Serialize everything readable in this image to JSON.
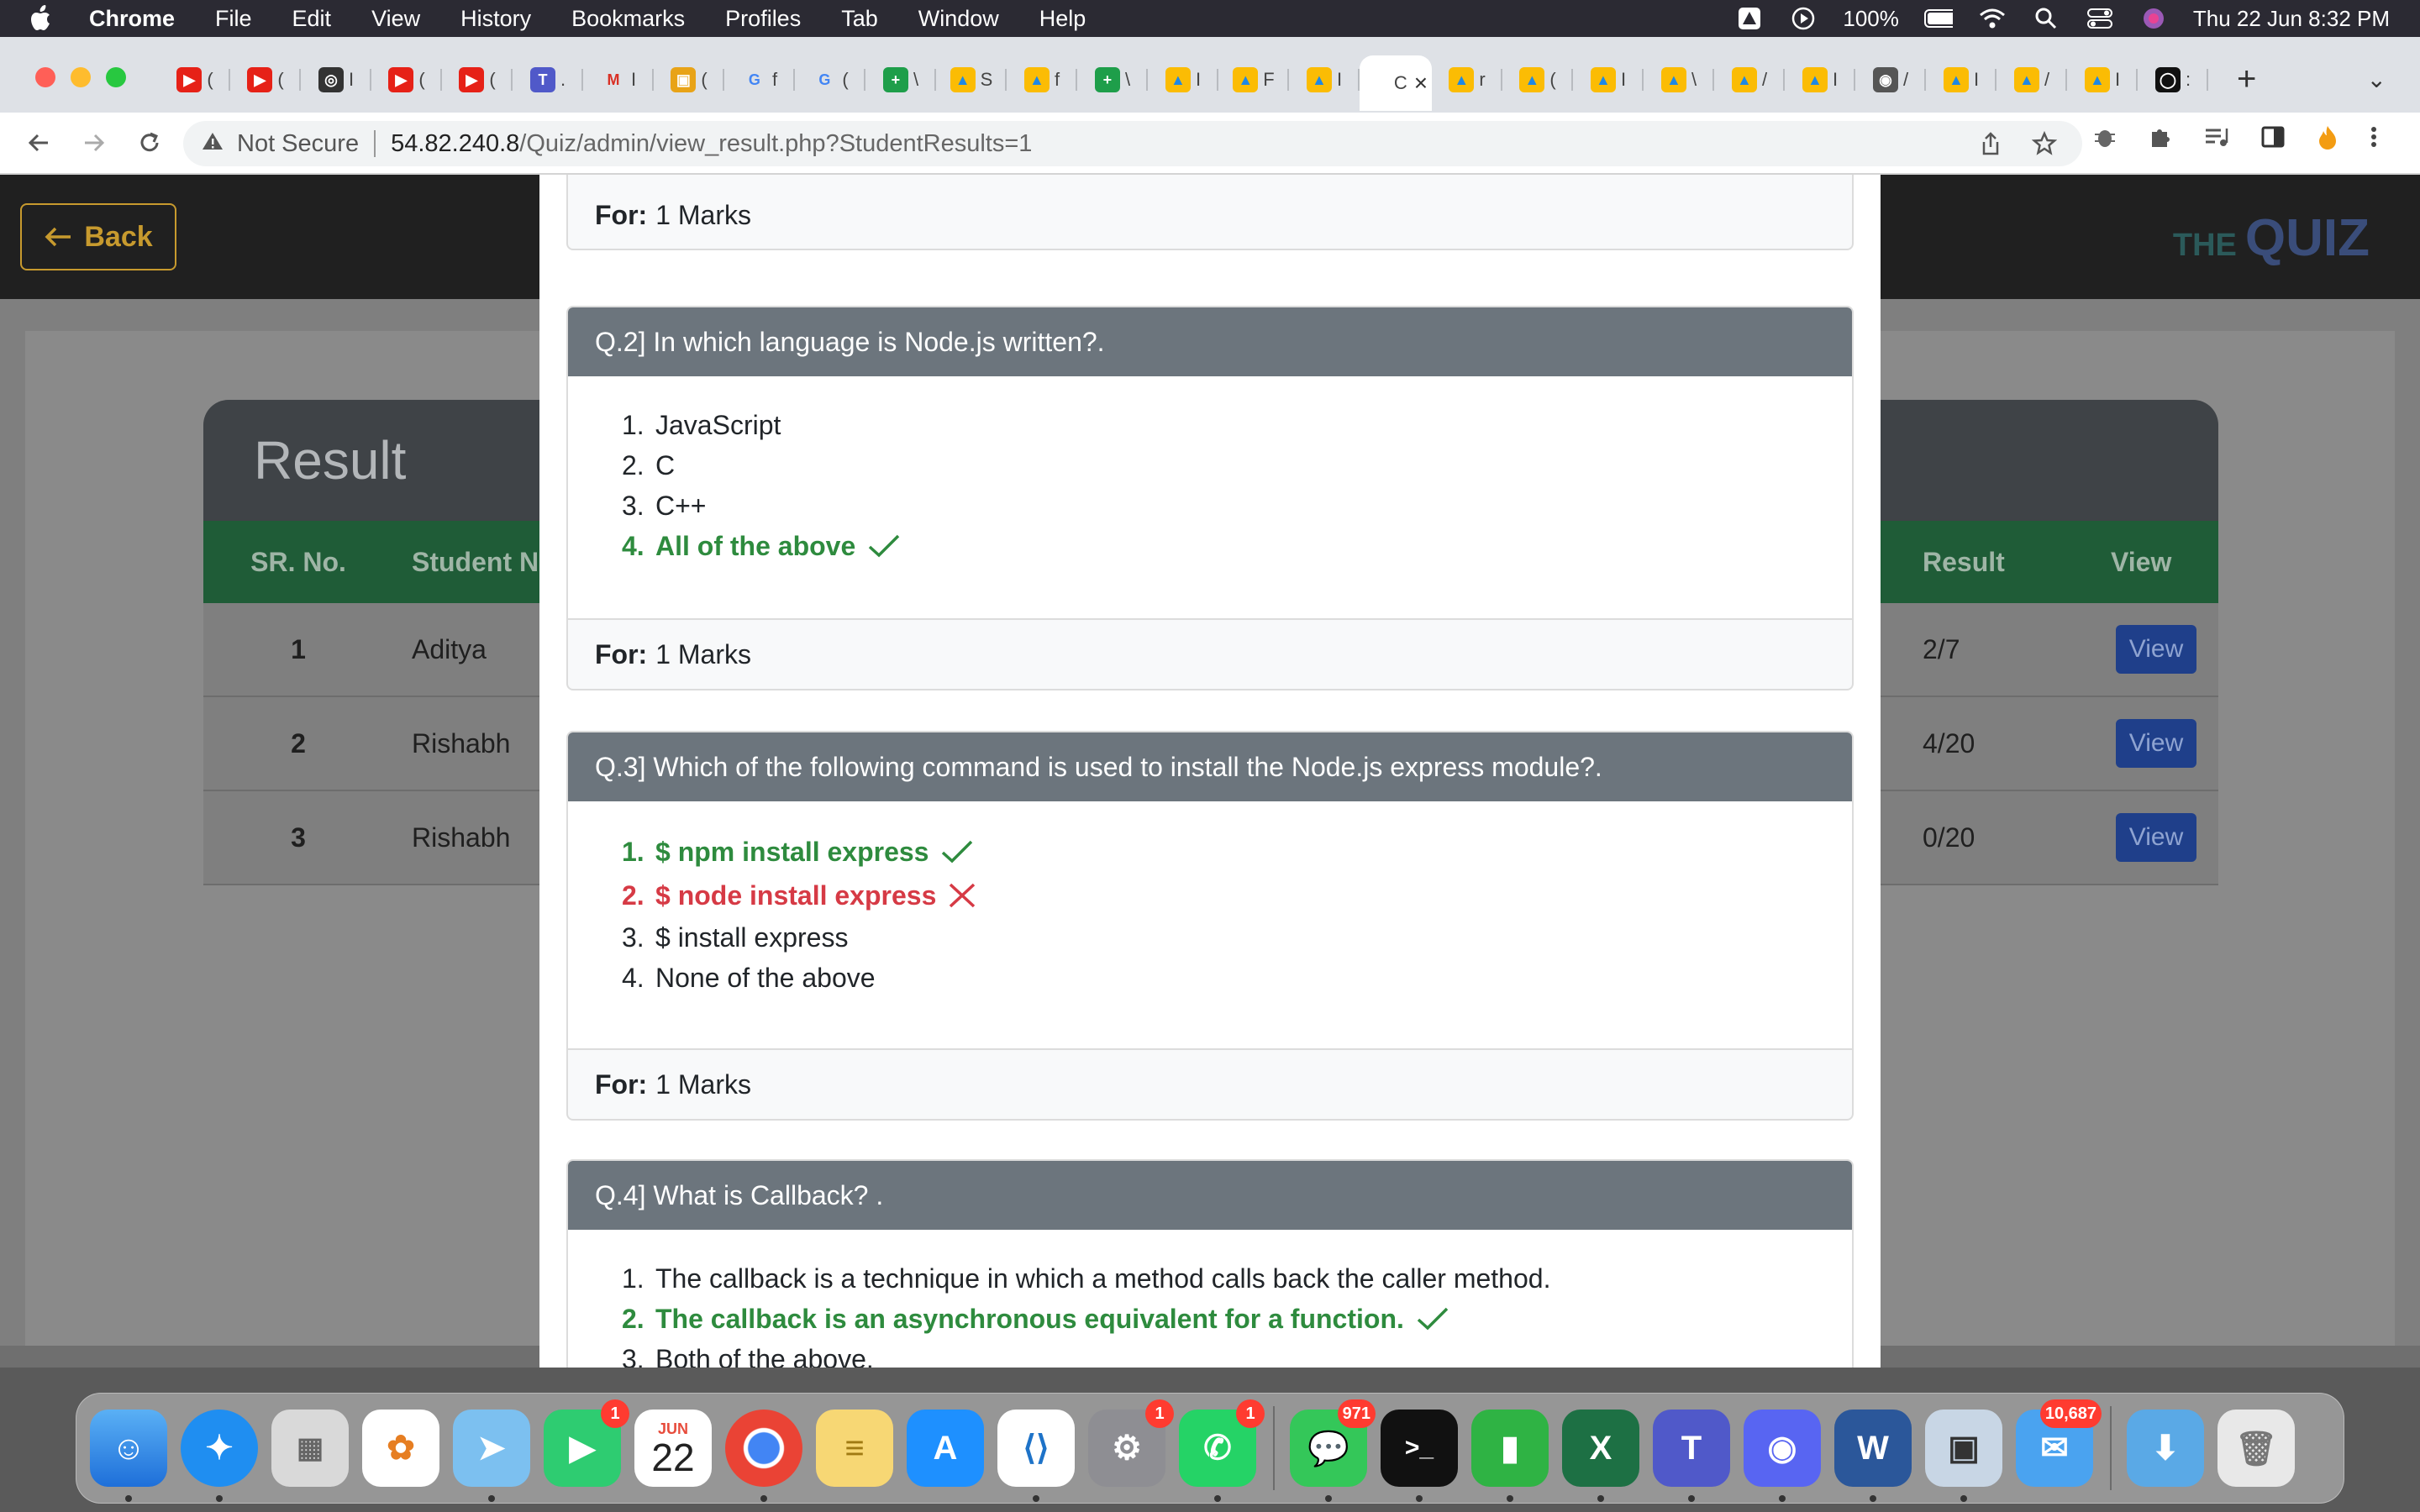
{
  "menubar": {
    "app": "Chrome",
    "items": [
      "File",
      "Edit",
      "View",
      "History",
      "Bookmarks",
      "Profiles",
      "Tab",
      "Window",
      "Help"
    ],
    "battery": "100%",
    "datetime": "Thu 22 Jun  8:32 PM"
  },
  "browser": {
    "tab_letters": [
      "(",
      "(",
      "I",
      "(",
      "(",
      ".",
      "I",
      "(",
      "f",
      "(",
      "\\",
      "S",
      "f",
      "\\",
      "I",
      "F",
      "I",
      "C",
      "r",
      "(",
      "I",
      "\\",
      "/",
      "I",
      "/",
      "I",
      "/",
      "I",
      ":"
    ],
    "address": {
      "security_label": "Not Secure",
      "host": "54.82.240.8",
      "path": "/Quiz/admin/view_result.php?StudentResults=1"
    }
  },
  "page": {
    "back_label": "Back",
    "brand_small": "THE",
    "brand_big": "QUIZ",
    "result_title": "Result",
    "columns": {
      "sr": "SR. No.",
      "name": "Student N",
      "result": "Result",
      "view": "View"
    },
    "rows": [
      {
        "sr": "1",
        "name": "Aditya",
        "result": "2/7",
        "view": "View"
      },
      {
        "sr": "2",
        "name": "Rishabh",
        "result": "4/20",
        "view": "View"
      },
      {
        "sr": "3",
        "name": "Rishabh",
        "result": "0/20",
        "view": "View"
      }
    ]
  },
  "modal": {
    "marks_label": "For:",
    "marks_value": "1 Marks",
    "q2": {
      "title": "Q.2] In which language is Node.js written?.",
      "options": [
        "JavaScript",
        "C",
        "C++",
        "All of the above"
      ]
    },
    "q3": {
      "title": "Q.3] Which of the following command is used to install the Node.js express module?.",
      "options": [
        "$ npm install express",
        "$ node install express",
        "$ install express",
        "None of the above"
      ]
    },
    "q4": {
      "title": "Q.4] What is Callback? .",
      "options": [
        "The callback is a technique in which a method calls back the caller method.",
        "The callback is an asynchronous equivalent for a function.",
        "Both of the above."
      ]
    }
  },
  "dock": {
    "calendar_month": "JUN",
    "calendar_day": "22",
    "badges": {
      "facetime": "1",
      "settings": "1",
      "whatsapp": "1",
      "messages": "971",
      "mail": "10,687"
    }
  },
  "colors": {
    "correct": "#2e8b3e",
    "wrong": "#d63a45",
    "question_header": "#6c757d",
    "back_accent": "#c79a2e"
  }
}
